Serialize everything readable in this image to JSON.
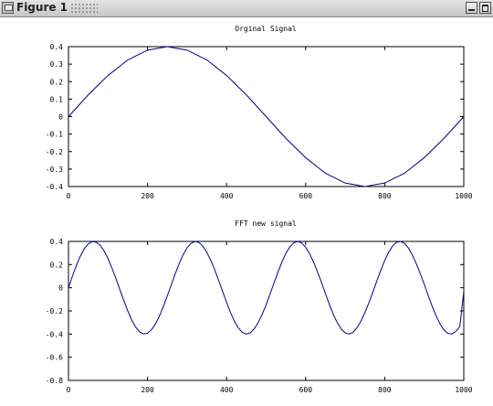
{
  "window": {
    "title": "Figure 1",
    "icon": "figure-window-icon",
    "controls": [
      "minimize-icon",
      "maximize-icon"
    ]
  },
  "chart_data": [
    {
      "type": "line",
      "title": "Orginal Signal",
      "xlabel": "",
      "ylabel": "",
      "xlim": [
        0,
        1000
      ],
      "ylim": [
        -0.4,
        0.4
      ],
      "x_ticks": [
        0,
        200,
        400,
        600,
        800,
        1000
      ],
      "x_tick_labels": [
        "0",
        "200",
        "400",
        "600",
        "800",
        "1000"
      ],
      "y_ticks": [
        0.4,
        0.3,
        0.2,
        0.1,
        0,
        -0.1,
        -0.2,
        -0.3,
        -0.4
      ],
      "y_tick_labels": [
        "0.4",
        "0.3",
        "0.2",
        "0.1",
        "0",
        "-0.1",
        "-0.2",
        "-0.3",
        "-0.4"
      ],
      "grid": false,
      "legend": "none",
      "line_color": "#00008b",
      "x": [
        0,
        50,
        100,
        150,
        200,
        250,
        300,
        350,
        400,
        450,
        500,
        550,
        600,
        650,
        700,
        750,
        800,
        850,
        900,
        950,
        1000
      ],
      "y": [
        0,
        0.124,
        0.235,
        0.324,
        0.38,
        0.4,
        0.38,
        0.324,
        0.235,
        0.124,
        0,
        -0.124,
        -0.235,
        -0.324,
        -0.38,
        -0.4,
        -0.38,
        -0.324,
        -0.235,
        -0.124,
        0
      ]
    },
    {
      "type": "line",
      "title": "FFT new signal",
      "xlabel": "",
      "ylabel": "",
      "xlim": [
        0,
        1000
      ],
      "ylim": [
        -0.8,
        0.4
      ],
      "x_ticks": [
        0,
        200,
        400,
        600,
        800,
        1000
      ],
      "x_tick_labels": [
        "0",
        "200",
        "400",
        "600",
        "800",
        "1000"
      ],
      "y_ticks": [
        0.4,
        0.2,
        0,
        -0.2,
        -0.4,
        -0.6,
        -0.8
      ],
      "y_tick_labels": [
        "0.4",
        "0.2",
        "0",
        "-0.2",
        "-0.4",
        "-0.6",
        "-0.8"
      ],
      "grid": false,
      "legend": "none",
      "line_color": "#00008b",
      "x": [
        0,
        10,
        20,
        30,
        40,
        50,
        60,
        70,
        80,
        90,
        100,
        110,
        120,
        130,
        140,
        150,
        160,
        170,
        180,
        190,
        200,
        210,
        220,
        230,
        240,
        250,
        260,
        270,
        280,
        290,
        300,
        310,
        320,
        330,
        340,
        350,
        360,
        370,
        380,
        390,
        400,
        410,
        420,
        430,
        440,
        450,
        460,
        470,
        480,
        490,
        500,
        510,
        520,
        530,
        540,
        550,
        560,
        570,
        580,
        590,
        600,
        610,
        620,
        630,
        640,
        650,
        660,
        670,
        680,
        690,
        700,
        710,
        720,
        730,
        740,
        750,
        760,
        770,
        780,
        790,
        800,
        810,
        820,
        830,
        840,
        850,
        860,
        870,
        880,
        890,
        900,
        910,
        920,
        930,
        940,
        950,
        960,
        970,
        980,
        990,
        1000
      ],
      "y": [
        0,
        0.1,
        0.193,
        0.273,
        0.336,
        0.378,
        0.398,
        0.394,
        0.367,
        0.319,
        0.252,
        0.17,
        0.079,
        -0.016,
        -0.111,
        -0.2,
        -0.279,
        -0.34,
        -0.381,
        -0.399,
        -0.393,
        -0.363,
        -0.313,
        -0.245,
        -0.162,
        -0.07,
        0.025,
        0.119,
        0.208,
        0.285,
        0.345,
        0.383,
        0.4,
        0.391,
        0.359,
        0.306,
        0.237,
        0.155,
        0.062,
        -0.033,
        -0.127,
        -0.215,
        -0.29,
        -0.349,
        -0.386,
        -0.4,
        -0.389,
        -0.354,
        -0.3,
        -0.229,
        -0.147,
        -0.054,
        0.041,
        0.136,
        0.222,
        0.296,
        0.353,
        0.388,
        0.4,
        0.387,
        0.35,
        0.294,
        0.221,
        0.137,
        0.046,
        -0.05,
        -0.144,
        -0.229,
        -0.302,
        -0.356,
        -0.39,
        -0.399,
        -0.385,
        -0.345,
        -0.287,
        -0.214,
        -0.129,
        -0.037,
        0.058,
        0.152,
        0.236,
        0.307,
        0.361,
        0.393,
        0.4,
        0.383,
        0.343,
        0.281,
        0.206,
        0.121,
        0.029,
        -0.067,
        -0.16,
        -0.243,
        -0.313,
        -0.365,
        -0.395,
        -0.399,
        -0.377,
        -0.336,
        -0.033
      ]
    }
  ]
}
